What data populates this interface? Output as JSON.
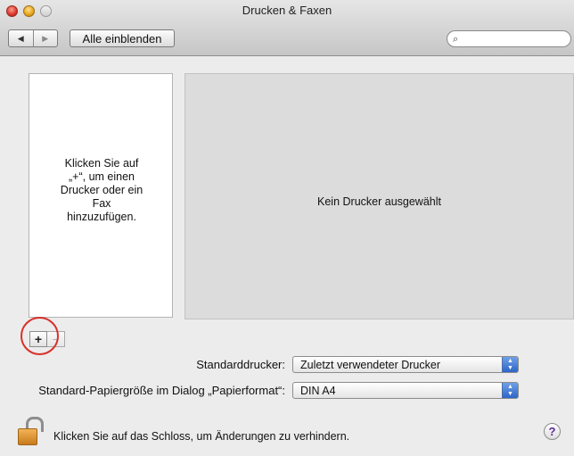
{
  "window": {
    "title": "Drucken & Faxen"
  },
  "toolbar": {
    "back_icon": "◀",
    "forward_icon": "▶",
    "show_all_label": "Alle einblenden",
    "search_icon": "magnifier-icon",
    "search_placeholder": ""
  },
  "printer_list": {
    "empty_message": "Klicken Sie auf\n„+“, um einen\nDrucker oder ein\nFax\nhinzuzufügen.",
    "add_button_label": "+",
    "remove_button_label": "−"
  },
  "detail": {
    "message": "Kein Drucker ausgewählt"
  },
  "settings": {
    "default_printer_label": "Standarddrucker:",
    "default_printer_value": "Zuletzt verwendeter Drucker",
    "paper_size_label": "Standard-Papiergröße im Dialog „Papierformat“:",
    "paper_size_value": "DIN A4"
  },
  "footer": {
    "lock_text": "Klicken Sie auf das Schloss, um Änderungen zu verhindern.",
    "help_label": "?"
  },
  "colors": {
    "highlight_circle": "#d8312b",
    "popup_accent": "#2d65c9"
  }
}
